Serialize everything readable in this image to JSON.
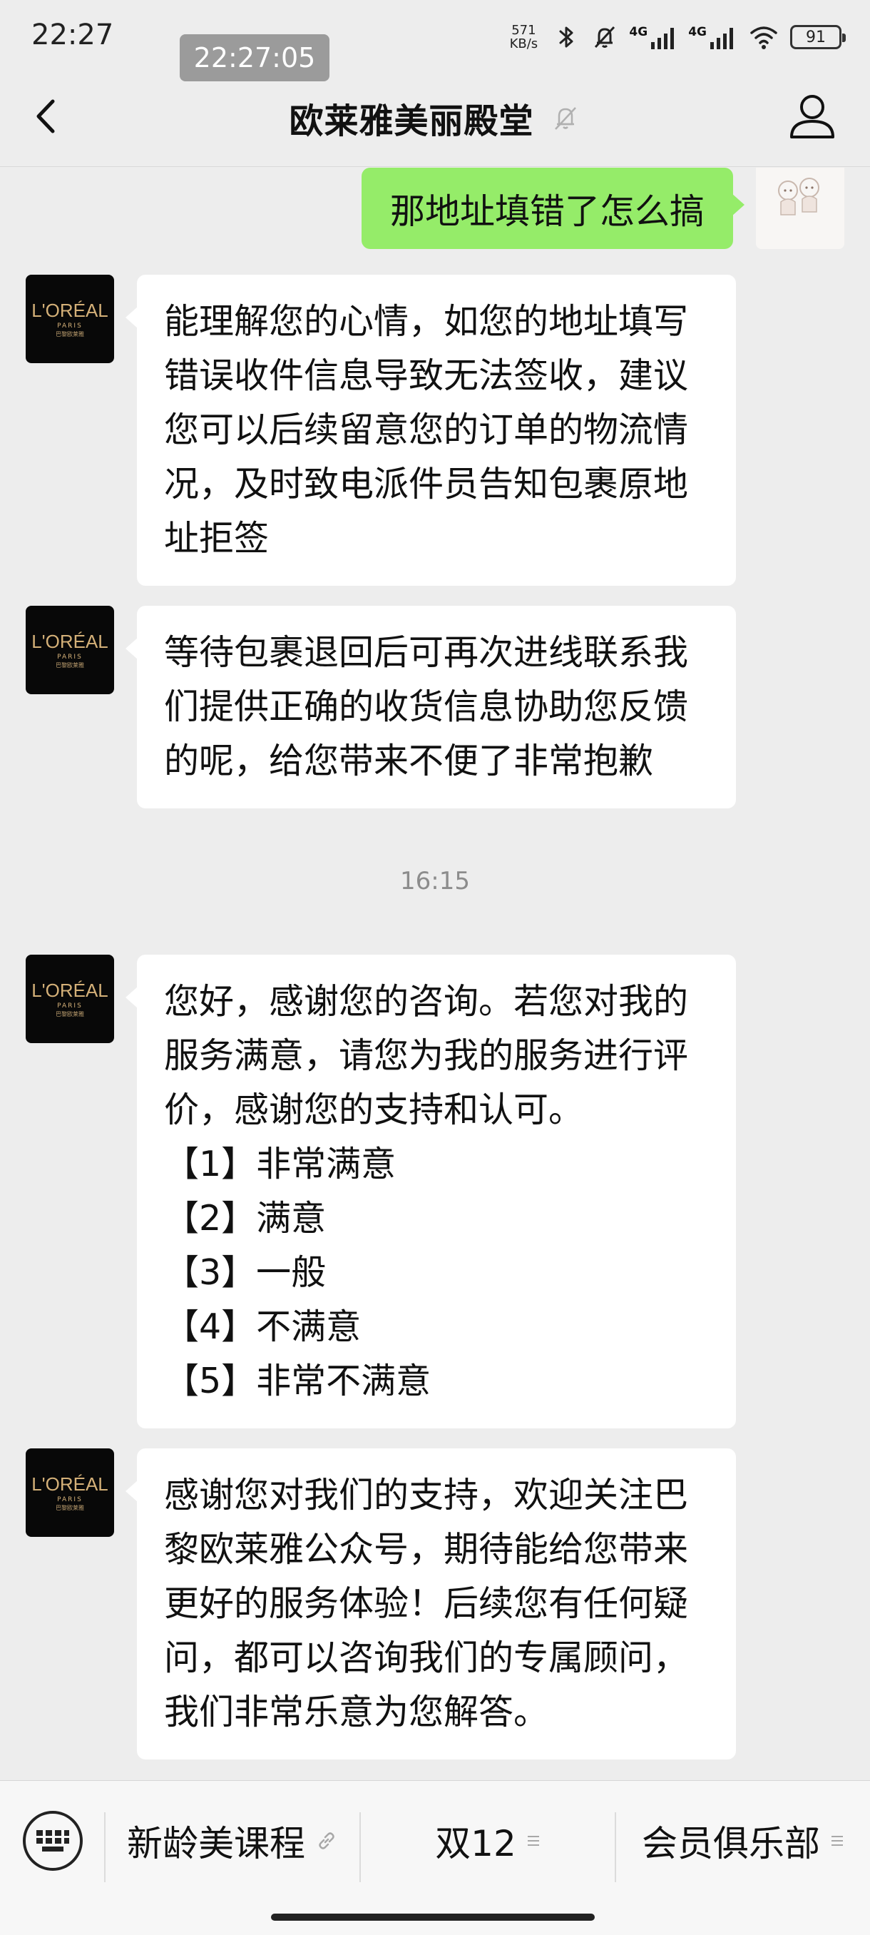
{
  "status_bar": {
    "time": "22:27",
    "net_speed_value": "571",
    "net_speed_unit": "KB/s",
    "signal_1": "4G",
    "signal_2": "4G",
    "battery": "91"
  },
  "toast_time": "22:27:05",
  "nav": {
    "title": "欧莱雅美丽殿堂"
  },
  "avatar_brand": {
    "name": "L'ORÉAL",
    "city": "PARIS",
    "chinese": "巴黎欧莱雅"
  },
  "messages": [
    {
      "side": "out",
      "text": "那地址填错了怎么搞"
    },
    {
      "side": "in",
      "text": "能理解您的心情，如您的地址填写\n错误收件信息导致无法签收，建议\n您可以后续留意您的订单的物流情\n况，及时致电派件员告知包裹原地\n址拒签"
    },
    {
      "side": "in",
      "text": "等待包裹退回后可再次进线联系我\n们提供正确的收货信息协助您反馈\n的呢，给您带来不便了非常抱歉"
    },
    {
      "side": "in",
      "text": "您好，感谢您的咨询。若您对我的\n服务满意，请您为我的服务进行评\n价，感谢您的支持和认可。\n【1】非常满意\n【2】满意\n【3】一般\n【4】不满意\n【5】非常不满意"
    },
    {
      "side": "in",
      "text": "感谢您对我们的支持，欢迎关注巴\n黎欧莱雅公众号，期待能给您带来\n更好的服务体验！后续您有任何疑\n问，都可以咨询我们的专属顾问，\n我们非常乐意为您解答。"
    }
  ],
  "chat_timestamp": "16:15",
  "bottom_menu": {
    "items": [
      {
        "label": "新龄美课程",
        "icon": "link-icon"
      },
      {
        "label": "双12",
        "icon": "menu-lines-icon"
      },
      {
        "label": "会员俱乐部",
        "icon": "menu-lines-icon"
      }
    ]
  },
  "colors": {
    "background": "#ededed",
    "outgoing_bubble": "#95ec69",
    "incoming_bubble": "#ffffff",
    "brand_gold": "#d4b078"
  }
}
